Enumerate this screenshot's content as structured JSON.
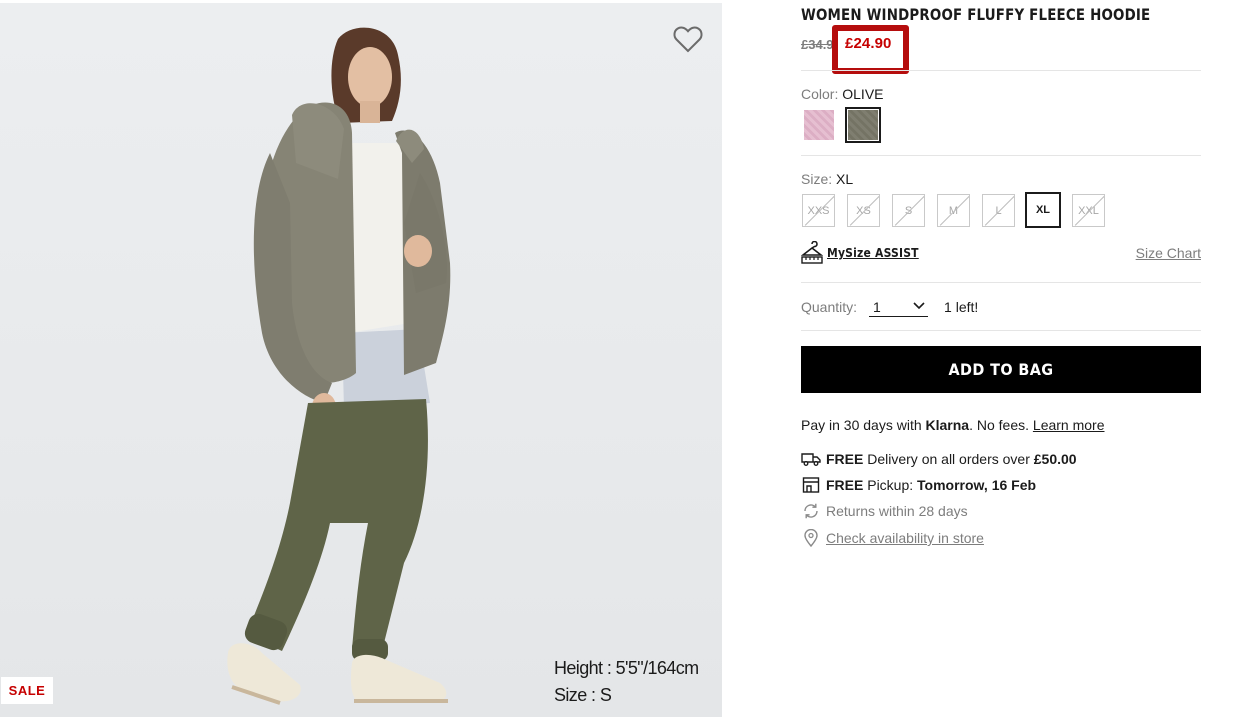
{
  "product": {
    "title": "WOMEN WINDPROOF FLUFFY FLEECE HOODIE",
    "old_price": "£34.90",
    "sale_price": "£24.90",
    "badge": "SALE",
    "model_height": "Height : 5'5\"/164cm",
    "model_size": "Size : S"
  },
  "color": {
    "label": "Color:",
    "value": "OLIVE",
    "swatches": [
      {
        "name": "pink",
        "hex": "#e3b7cc",
        "selected": false
      },
      {
        "name": "olive",
        "hex": "#7b7a6c",
        "selected": true
      }
    ]
  },
  "size": {
    "label": "Size:",
    "value": "XL",
    "options": [
      {
        "label": "XXS",
        "available": false,
        "selected": false
      },
      {
        "label": "XS",
        "available": false,
        "selected": false
      },
      {
        "label": "S",
        "available": false,
        "selected": false
      },
      {
        "label": "M",
        "available": false,
        "selected": false
      },
      {
        "label": "L",
        "available": false,
        "selected": false
      },
      {
        "label": "XL",
        "available": true,
        "selected": true
      },
      {
        "label": "XXL",
        "available": false,
        "selected": false
      }
    ],
    "mysize_label": "MySize ASSIST",
    "chart_link": "Size Chart"
  },
  "quantity": {
    "label": "Quantity:",
    "value": "1",
    "stock_note": "1 left!"
  },
  "cta": {
    "add_to_bag": "ADD TO BAG"
  },
  "klarna": {
    "prefix": "Pay in 30 days with",
    "brand": "Klarna",
    "suffix": ". No fees.",
    "link": "Learn more"
  },
  "delivery": {
    "free": "FREE",
    "delivery_text": "Delivery on all orders over",
    "threshold": "£50.00",
    "pickup_label": "Pickup:",
    "pickup_time": "Tomorrow, 16 Feb",
    "returns": "Returns within 28 days",
    "store_link": "Check availability in store"
  },
  "colors": {
    "sale_red": "#c60000",
    "highlight_red": "#b50d0d",
    "button_black": "#000000",
    "muted_gray": "#7d7d7d"
  },
  "icons": {
    "wishlist": "heart-outline-icon",
    "mysize": "hanger-ruler-icon",
    "quantity": "chevron-down-icon",
    "delivery": "truck-icon",
    "pickup": "store-icon",
    "returns": "return-arrows-icon",
    "store": "location-pin-icon"
  }
}
